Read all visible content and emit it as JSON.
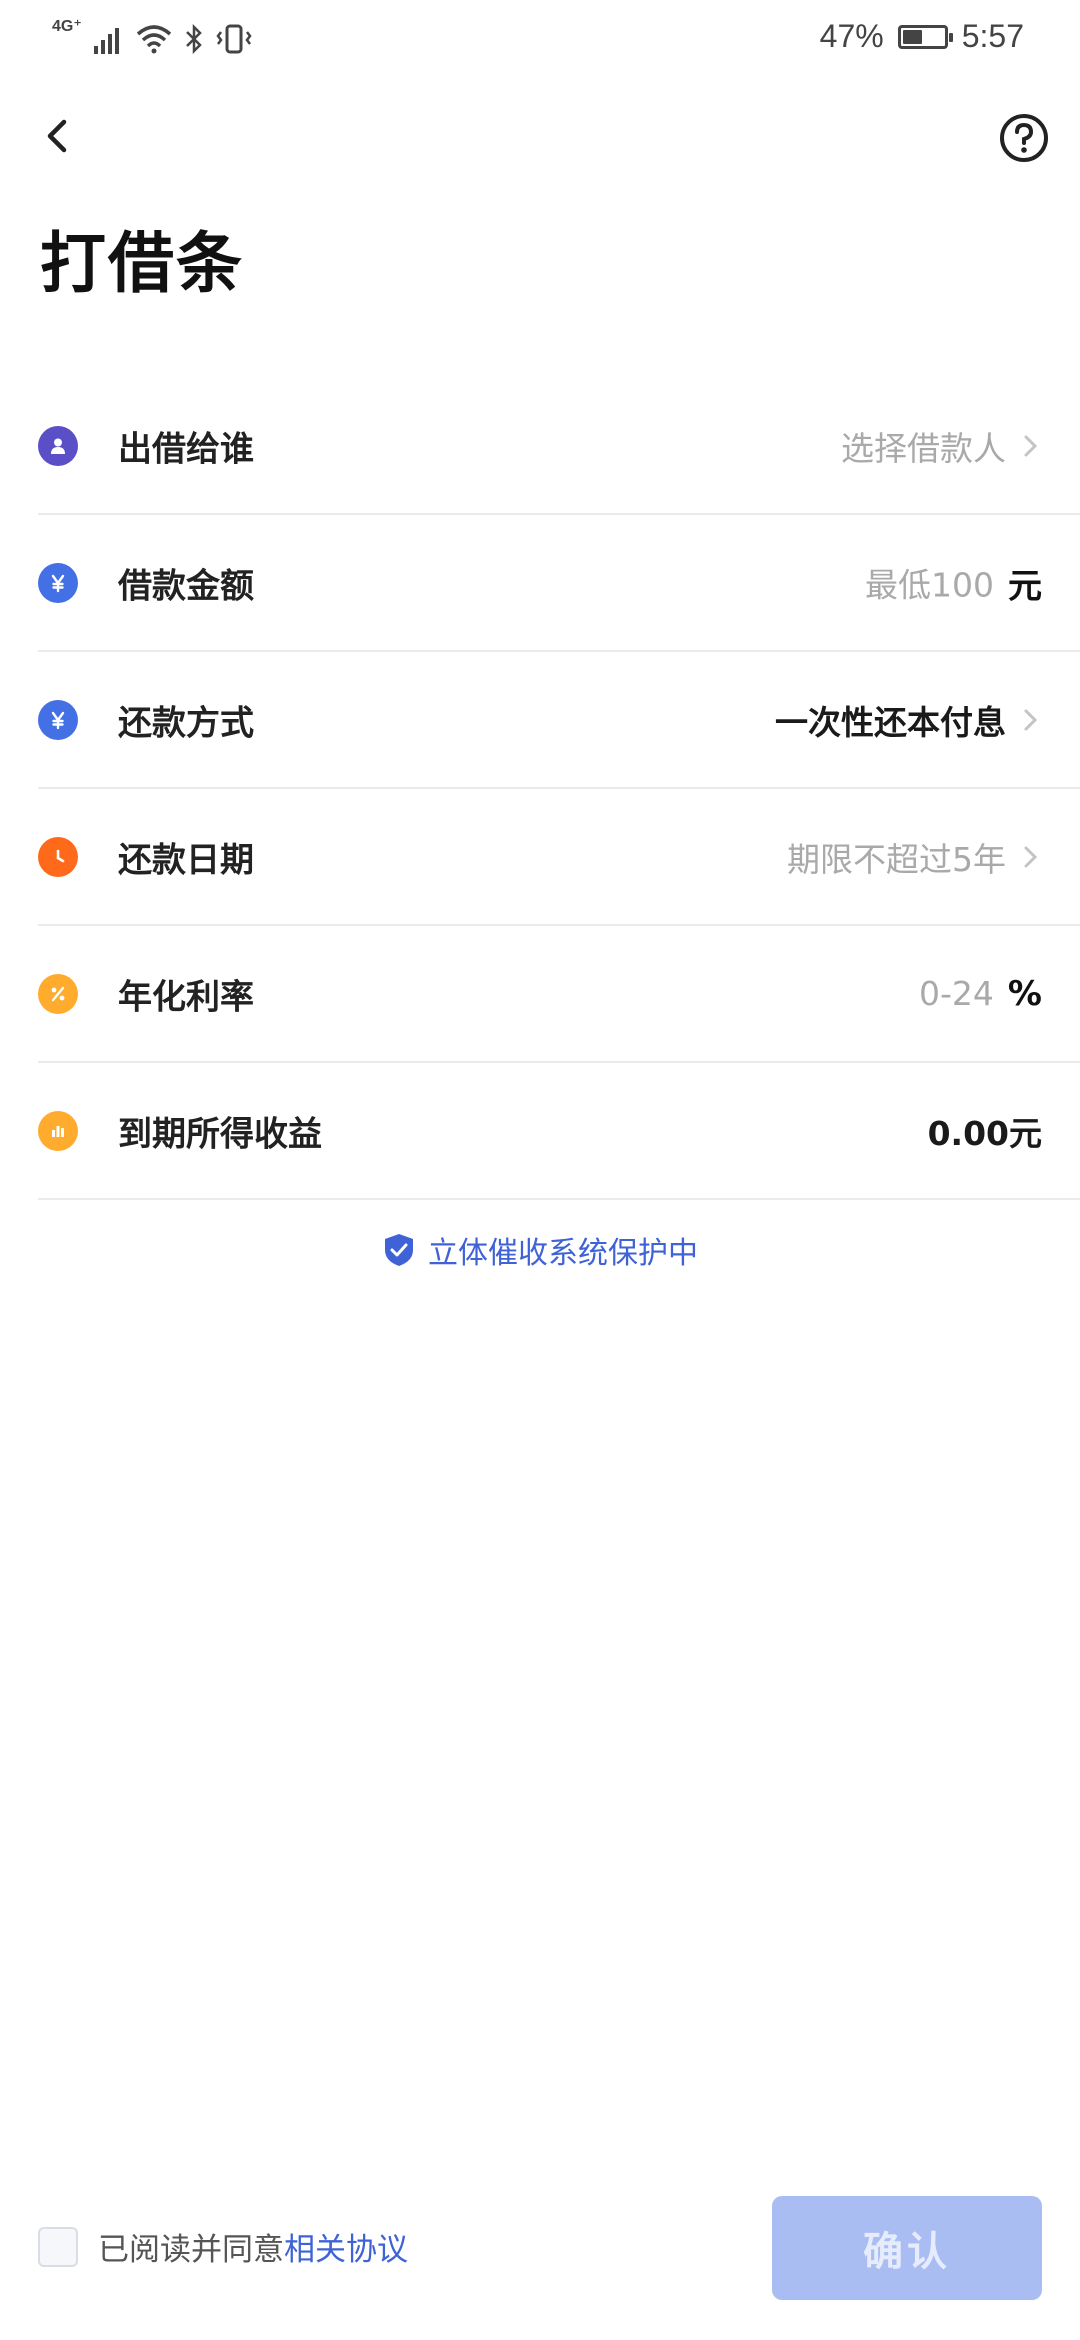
{
  "status_bar": {
    "network": "4G⁺",
    "battery": "47%",
    "battery_level": 0.47,
    "time": "5:57"
  },
  "header": {
    "title": "打借条",
    "back_icon": "chevron-left-icon",
    "help_icon": "question-circle-icon"
  },
  "rows": [
    {
      "label": "出借给谁",
      "value": "选择借款人",
      "value_style": "placeholder",
      "icon": "person-icon",
      "icon_color": "#5b4fc7",
      "has_chevron": true
    },
    {
      "label": "借款金额",
      "value": "最低100",
      "unit": "元",
      "value_style": "placeholder",
      "icon": "yuan-icon",
      "icon_color": "#4470e6",
      "has_chevron": false
    },
    {
      "label": "还款方式",
      "value": "一次性还本付息",
      "value_style": "strong",
      "icon": "yuan-icon",
      "icon_color": "#4470e6",
      "has_chevron": true
    },
    {
      "label": "还款日期",
      "value": "期限不超过5年",
      "value_style": "placeholder",
      "icon": "clock-icon",
      "icon_color": "#ff6a1a",
      "has_chevron": true
    },
    {
      "label": "年化利率",
      "value": "0-24",
      "unit": "%",
      "value_style": "placeholder",
      "icon": "percent-icon",
      "icon_color": "#ffab2e",
      "has_chevron": false
    },
    {
      "label": "到期所得收益",
      "value": "0.00元",
      "value_style": "strong",
      "icon": "bar-chart-icon",
      "icon_color": "#ffab2e",
      "has_chevron": false
    }
  ],
  "protection_note": "立体催收系统保护中",
  "agreement": {
    "text": "已阅读并同意",
    "link": "相关协议",
    "checked": false
  },
  "confirm_label": "确认",
  "colors": {
    "accent": "#3f63d6",
    "button_disabled": "#a9bdf3"
  }
}
